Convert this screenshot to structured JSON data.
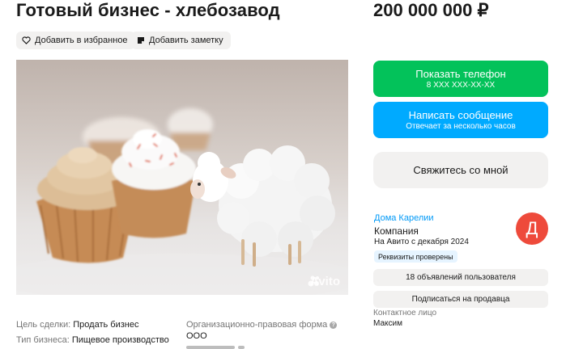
{
  "listing": {
    "title": "Готовый бизнес - хлебозавод",
    "price": "200 000 000 ₽"
  },
  "actions": {
    "favorite_label": "Добавить в избранное",
    "note_label": "Добавить заметку"
  },
  "photo": {
    "watermark": "Avito"
  },
  "buttons": {
    "phone_label": "Показать телефон",
    "phone_number": "8 XXX XXX-XX-XX",
    "message_label": "Написать сообщение",
    "message_sub": "Отвечает за несколько часов",
    "contact_label": "Свяжитесь со мной"
  },
  "seller": {
    "name": "Дома Карелии",
    "type": "Компания",
    "since": "На Авито с декабря 2024",
    "verified_badge": "Реквизиты проверены",
    "avatar_letter": "Д",
    "ads_count_label": "18 объявлений пользователя",
    "subscribe_label": "Подписаться на продавца",
    "contact_person_label": "Контактное лицо",
    "contact_person": "Максим"
  },
  "params": {
    "goal_key": "Цель сделки:",
    "goal_value": "Продать бизнес",
    "type_key": "Тип бизнеса:",
    "type_value": "Пищевое производство",
    "org_form_key": "Организационно-правовая форма",
    "org_form_value": "ООО"
  },
  "colors": {
    "phone_button": "#03c25a",
    "message_button": "#00aaff",
    "seller_link": "#0099f7",
    "avatar": "#ee4a3b"
  }
}
